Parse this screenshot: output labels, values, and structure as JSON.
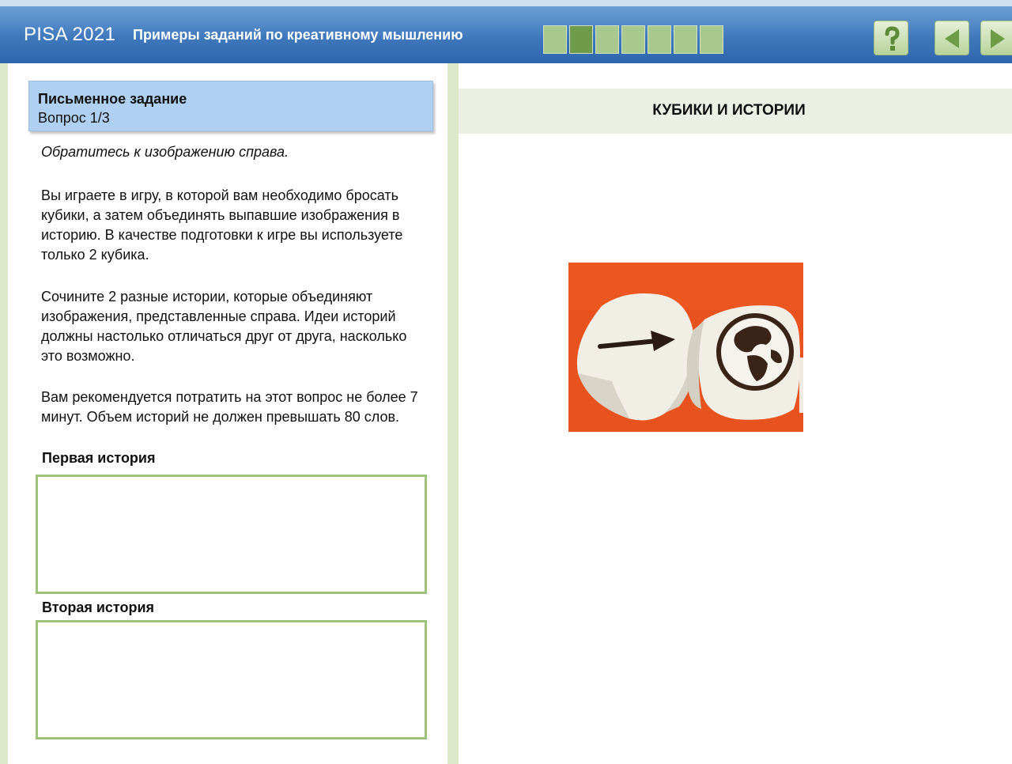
{
  "header": {
    "brand": "PISA 2021",
    "unit_title": "Примеры заданий по креативному мышлению",
    "progress": {
      "total": 7,
      "current": 2
    },
    "help_icon": "question-mark-icon",
    "back_icon": "triangle-left-icon",
    "next_icon": "triangle-right-icon"
  },
  "task": {
    "title": "Письменное задание",
    "question": "Вопрос 1/3",
    "paragraphs": {
      "intro": "Обратитесь к изображению справа.",
      "game": "Вы играете в игру, в которой вам необходимо бросать кубики, а затем объединять выпавшие изображения в историю. В качестве подготовки к игре вы используете только 2 кубика.",
      "compose": "Сочините 2 разные истории, которые объединяют изображения, представленные справа. Идеи историй должны настолько отличаться друг от друга, насколько это возможно.",
      "time": "Вам рекомендуется потратить на этот вопрос не более 7 минут. Объем историй не должен превышать 80 слов."
    },
    "story1": {
      "label": "Первая история",
      "value": ""
    },
    "story2": {
      "label": "Вторая история",
      "value": ""
    }
  },
  "stimulus": {
    "title": "КУБИКИ И ИСТОРИИ",
    "image_icons": [
      "arrow-icon",
      "globe-icon"
    ],
    "colors": {
      "background": "#e8521e",
      "dice": "#f1eee6"
    }
  }
}
